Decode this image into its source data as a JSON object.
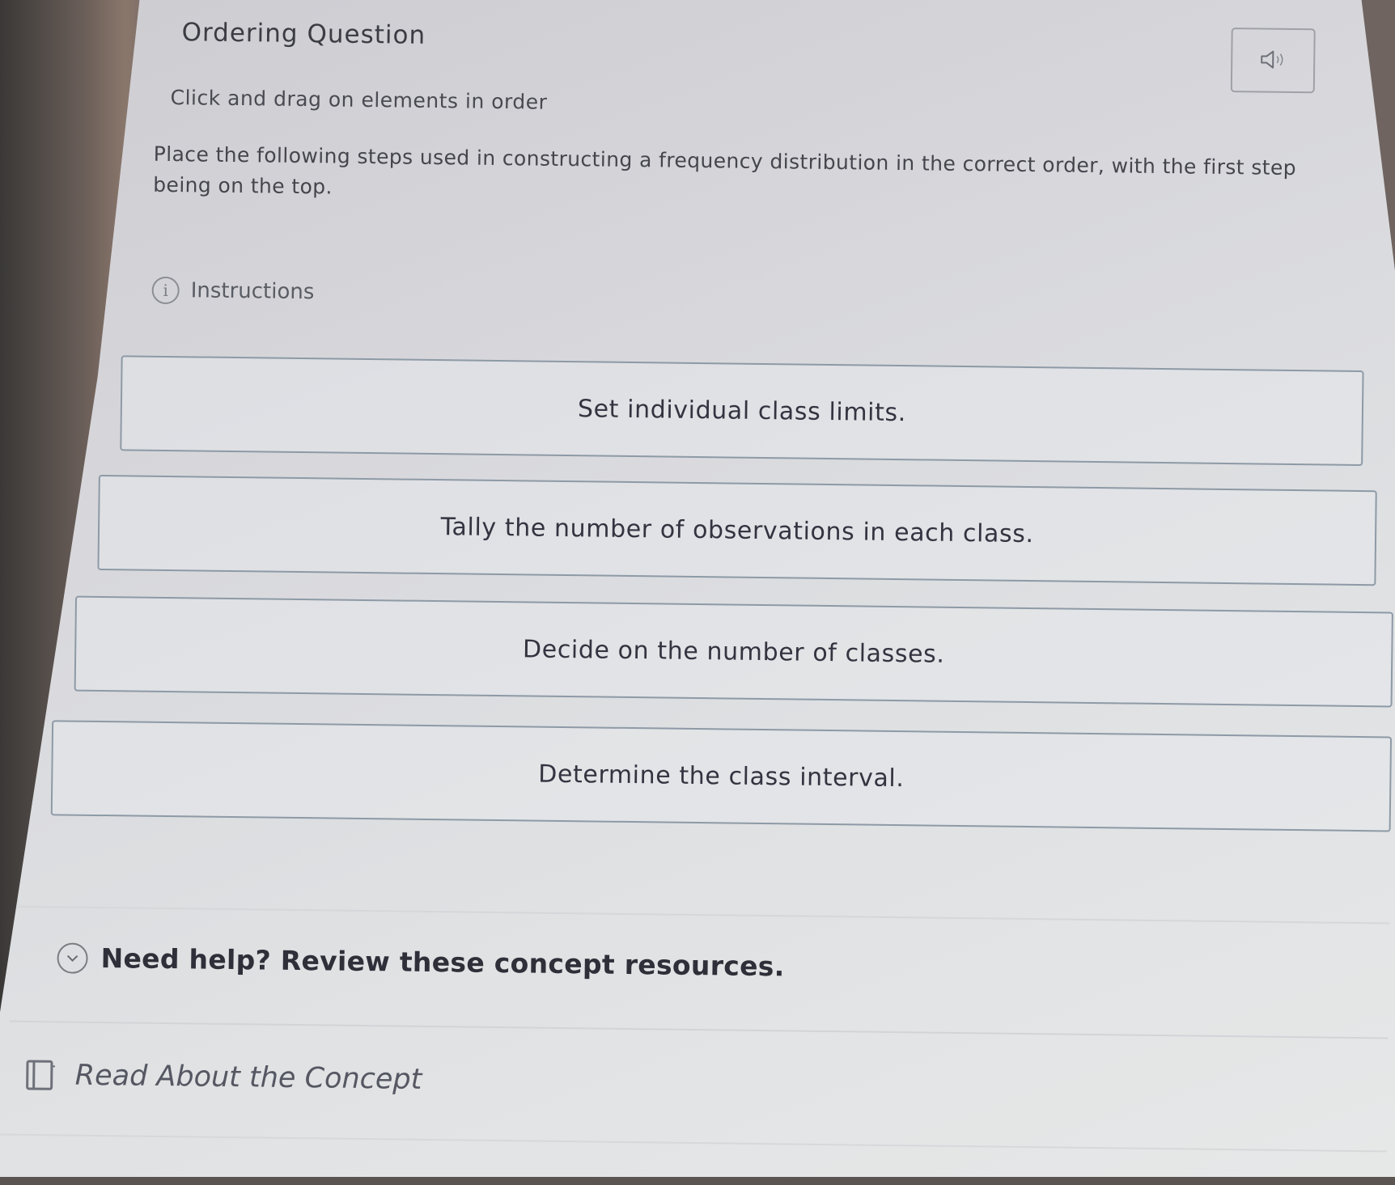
{
  "question": {
    "title": "Ordering Question",
    "subtitle": "Click and drag on elements in order",
    "prompt": "Place the following steps used in constructing a frequency distribution in the correct order, with the first step being on the top."
  },
  "instructions": {
    "label": "Instructions",
    "icon": "info-icon"
  },
  "audio_button": {
    "icon": "speaker-icon"
  },
  "items": [
    {
      "label": "Set individual class limits."
    },
    {
      "label": "Tally the number of observations in each class."
    },
    {
      "label": "Decide on the number of classes."
    },
    {
      "label": "Determine the class interval."
    }
  ],
  "help": {
    "label": "Need help? Review these concept resources.",
    "icon": "chevron-circle-icon"
  },
  "resources": [
    {
      "label": "Read About the Concept",
      "icon": "book-icon"
    }
  ]
}
